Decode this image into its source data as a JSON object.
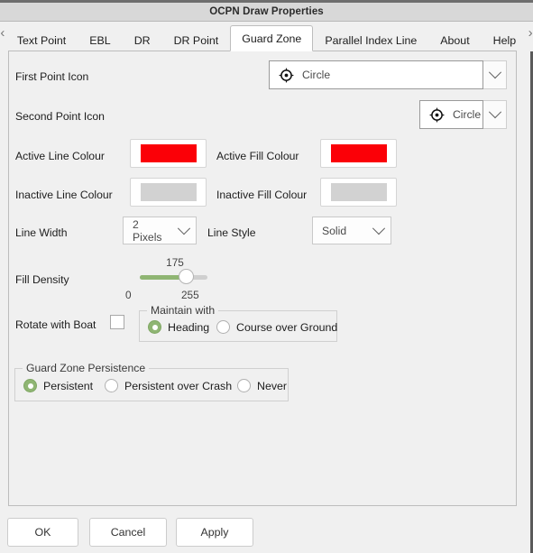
{
  "window": {
    "title": "OCPN Draw Properties"
  },
  "tabbar": {
    "scroll_left": "‹",
    "scroll_right": "›",
    "tabs": [
      {
        "label": "Text Point",
        "active": false
      },
      {
        "label": "EBL",
        "active": false
      },
      {
        "label": "DR",
        "active": false
      },
      {
        "label": "DR Point",
        "active": false
      },
      {
        "label": "Guard Zone",
        "active": true
      },
      {
        "label": "Parallel Index Line",
        "active": false
      },
      {
        "label": "About",
        "active": false
      },
      {
        "label": "Help",
        "active": false
      }
    ]
  },
  "form": {
    "first_point_icon": {
      "label": "First Point Icon",
      "value": "Circle",
      "icon": "circle-target-icon"
    },
    "second_point_icon": {
      "label": "Second Point Icon",
      "value": "Circle",
      "icon": "circle-target-icon"
    },
    "active_line_colour": {
      "label": "Active Line Colour",
      "colour": "#fb0007"
    },
    "active_fill_colour": {
      "label": "Active Fill Colour",
      "colour": "#fb0007"
    },
    "inactive_line_colour": {
      "label": "Inactive Line Colour",
      "colour": "#d2d2d2"
    },
    "inactive_fill_colour": {
      "label": "Inactive Fill Colour",
      "colour": "#d2d2d2"
    },
    "line_width": {
      "label": "Line Width",
      "value": "2 Pixels"
    },
    "line_style": {
      "label": "Line Style",
      "value": "Solid"
    },
    "fill_density": {
      "label": "Fill Density",
      "value": "175",
      "min": "0",
      "max": "255",
      "percent": 68.6,
      "accent": "#8fb573"
    },
    "rotate_with_boat": {
      "label": "Rotate with Boat",
      "checked": false
    },
    "maintain_with": {
      "title": "Maintain with",
      "options": [
        {
          "label": "Heading",
          "selected": true
        },
        {
          "label": "Course over Ground",
          "selected": false
        }
      ]
    },
    "guard_zone_persistence": {
      "title": "Guard Zone Persistence",
      "options": [
        {
          "label": "Persistent",
          "selected": true
        },
        {
          "label": "Persistent over Crash",
          "selected": false
        },
        {
          "label": "Never",
          "selected": false
        }
      ]
    }
  },
  "buttons": {
    "ok": "OK",
    "cancel": "Cancel",
    "apply": "Apply"
  }
}
